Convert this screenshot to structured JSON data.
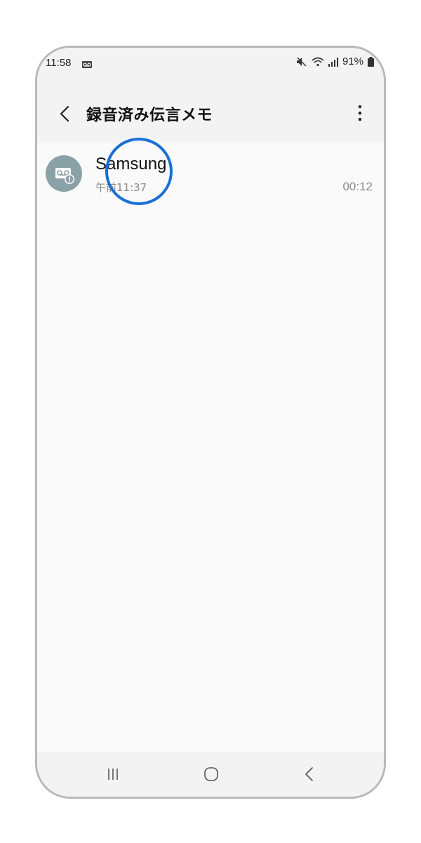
{
  "status_bar": {
    "time": "11:58",
    "battery": "91%",
    "icons": [
      "voicemail-icon",
      "mute-icon",
      "wifi-icon",
      "signal-icon",
      "battery-icon"
    ]
  },
  "app_bar": {
    "title": "録音済み伝言メモ",
    "back_icon": "chevron-left-icon",
    "more_icon": "more-vertical-icon"
  },
  "recordings": [
    {
      "name": "Samsung",
      "time": "午前11:37",
      "duration": "00:12",
      "icon": "voicemail-alert-icon"
    }
  ],
  "nav_bar": {
    "items": [
      "recent-apps-icon",
      "home-icon",
      "back-icon"
    ]
  },
  "colors": {
    "highlight": "#1a6fd6",
    "avatar_bg": "#8aa1a8",
    "background": "#fafafa",
    "bar_bg": "#f3f3f3"
  }
}
